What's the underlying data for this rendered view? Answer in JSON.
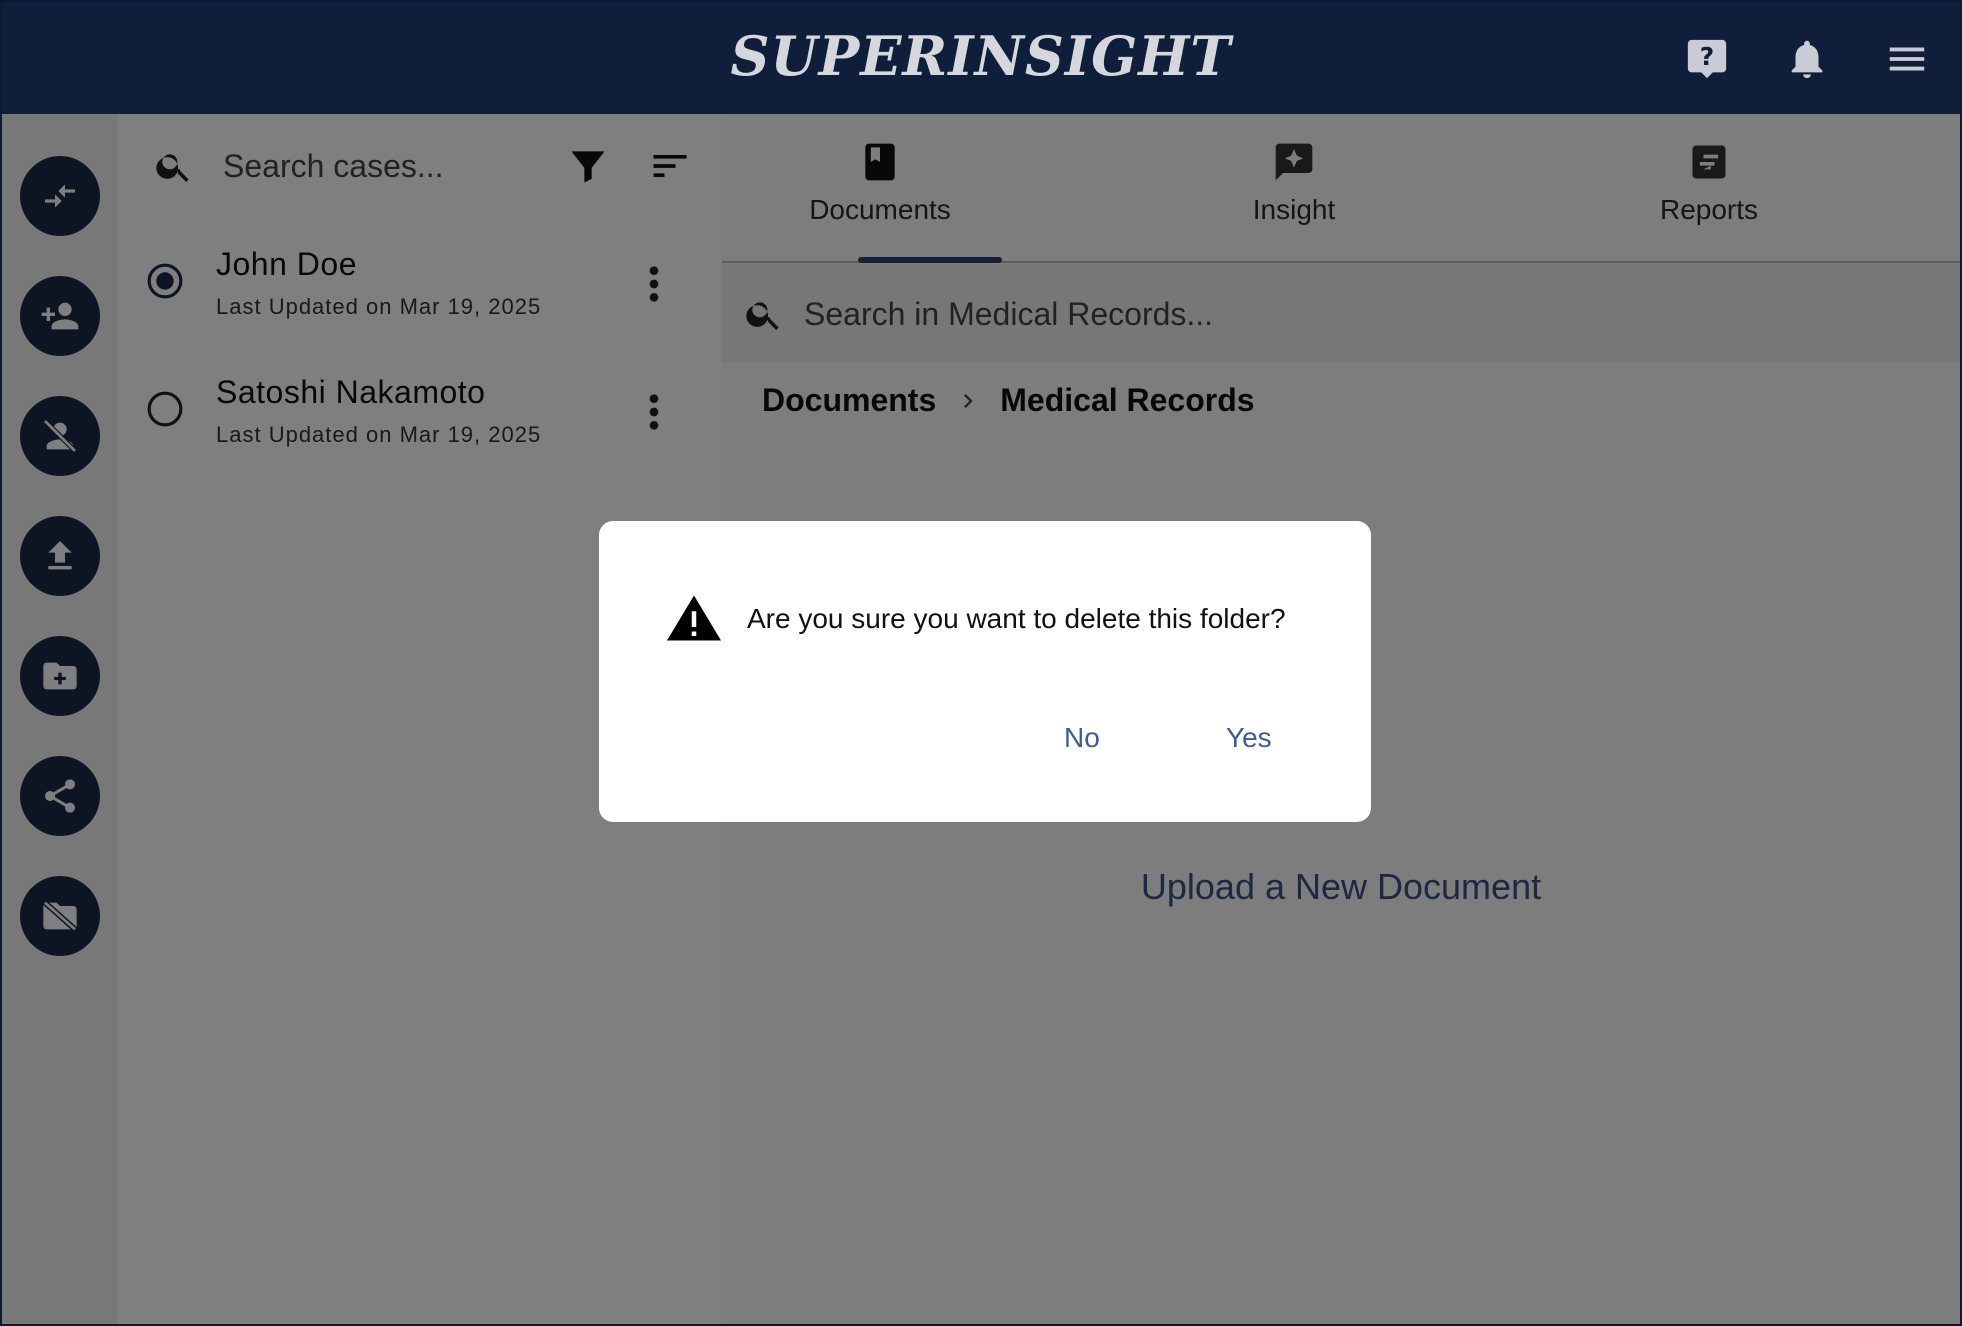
{
  "header": {
    "brand": "SUPERINSIGHT",
    "icons": [
      "help-icon",
      "notifications-icon",
      "menu-icon"
    ]
  },
  "rail": {
    "buttons": [
      "compare-arrows-icon",
      "add-person-icon",
      "remove-person-icon",
      "upload-icon",
      "new-folder-icon",
      "share-icon",
      "delete-folder-icon"
    ]
  },
  "cases": {
    "search_placeholder": "Search cases...",
    "items": [
      {
        "name": "John Doe",
        "updated": "Last Updated on Mar 19, 2025",
        "selected": true
      },
      {
        "name": "Satoshi Nakamoto",
        "updated": "Last Updated on Mar 19, 2025",
        "selected": false
      }
    ]
  },
  "main": {
    "tabs": [
      {
        "label": "Documents",
        "icon": "book-icon",
        "active": true
      },
      {
        "label": "Insight",
        "icon": "sparkle-chat-icon",
        "active": false
      },
      {
        "label": "Reports",
        "icon": "report-icon",
        "active": false
      }
    ],
    "search_placeholder": "Search in Medical Records...",
    "breadcrumb": [
      "Documents",
      "Medical Records"
    ],
    "upload_link": "Upload a New Document"
  },
  "dialog": {
    "message": "Are you sure you want to delete this folder?",
    "no_label": "No",
    "yes_label": "Yes",
    "icon": "warning-icon"
  },
  "colors": {
    "header_bg": "#0f1e3a",
    "fab_bg": "#1b2a4a",
    "link": "#3f5b92",
    "scrim": "rgba(0,0,0,0.5)"
  }
}
